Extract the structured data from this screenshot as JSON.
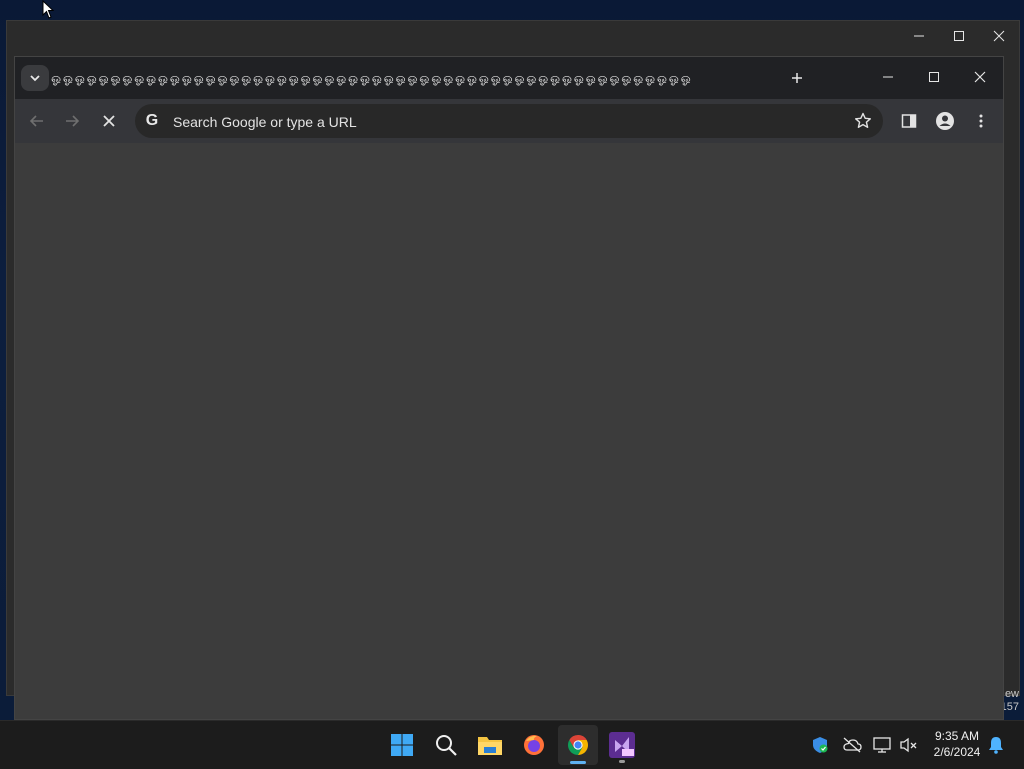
{
  "background_window": {
    "side_label_line1": "ew",
    "side_label_line2": "157"
  },
  "browser": {
    "tabs_text": "ஓ ஓ ஓ ஓ ஓ ஓ ஓ ஓ ஓ ஓ ஓ ஓ ஓ ஓ ஓ ஓ ஓ ஓ ஓ ஓ ஓ ஓ ஓ ஓ ஓ ஓ ஓ ஓ ஓ ஓ ஓ ஓ ஓ ஓ ஓ ஓ ஓ ஓ ஓ ஓ ஓ ஓ ஓ ஓ ஓ ஓ ஓ ஓ ஓ ஓ ஓ ஓ ஓ ஓ",
    "omnibox_placeholder": "Search Google or type a URL",
    "omnibox_icon": "G"
  },
  "taskbar": {
    "apps": [
      "windows-start-icon",
      "search-icon",
      "file-explorer-icon",
      "firefox-icon",
      "chrome-icon",
      "visual-studio-preview-icon"
    ],
    "time": "9:35 AM",
    "date": "2/6/2024"
  },
  "colors": {
    "accent": "#5fb2f2",
    "page_background": "#3c3c3c",
    "toolbar": "#35363a",
    "tabstrip": "#202124"
  }
}
